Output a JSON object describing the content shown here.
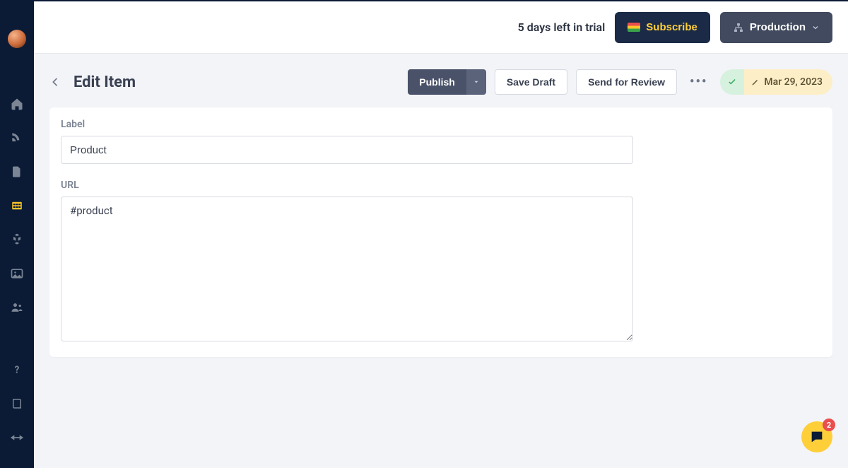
{
  "header": {
    "trial_text": "5 days left in trial",
    "subscribe_label": "Subscribe",
    "environment_label": "Production"
  },
  "sidebar": {
    "icons": [
      "home-icon",
      "blog-icon",
      "document-icon",
      "grid-icon",
      "blocks-icon",
      "media-icon",
      "users-icon",
      "help-icon",
      "book-icon",
      "api-icon"
    ],
    "active_index": 3
  },
  "page": {
    "title": "Edit Item",
    "publish_label": "Publish",
    "save_draft_label": "Save Draft",
    "send_review_label": "Send for Review",
    "status_date": "Mar 29, 2023"
  },
  "form": {
    "label_field": {
      "label": "Label",
      "value": "Product"
    },
    "url_field": {
      "label": "URL",
      "value": "#product"
    }
  },
  "chat": {
    "badge_count": "2"
  }
}
